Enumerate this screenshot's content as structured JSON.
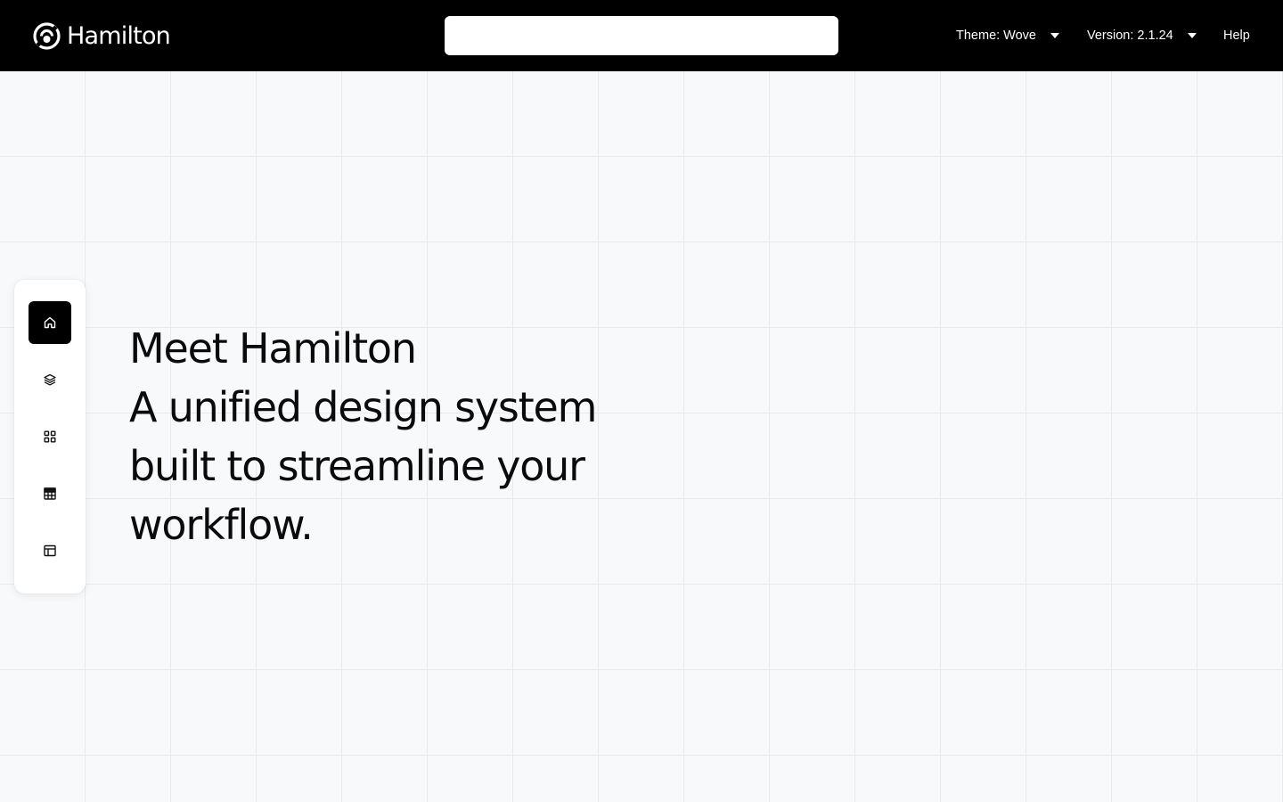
{
  "header": {
    "brand_name": "Hamilton",
    "search": {
      "value": "",
      "placeholder": ""
    },
    "theme_dropdown": {
      "label": "Theme: Wove"
    },
    "version_dropdown": {
      "label": "Version: 2.1.24"
    },
    "help_link": {
      "label": "Help"
    }
  },
  "sidebar": {
    "items": [
      {
        "icon": "home-icon",
        "active": true
      },
      {
        "icon": "layers-icon",
        "active": false
      },
      {
        "icon": "grid-icon",
        "active": false
      },
      {
        "icon": "table-icon",
        "active": false
      },
      {
        "icon": "layout-icon",
        "active": false
      }
    ]
  },
  "hero": {
    "lines": [
      "Meet Hamilton",
      "A unified design system",
      "built to streamline your",
      "workflow."
    ]
  },
  "colors": {
    "header_bg": "#000000",
    "page_bg": "#f8f9fb",
    "grid_line": "#e8e9ed",
    "active_item_bg": "#000000",
    "text": "#0b0b0b"
  }
}
